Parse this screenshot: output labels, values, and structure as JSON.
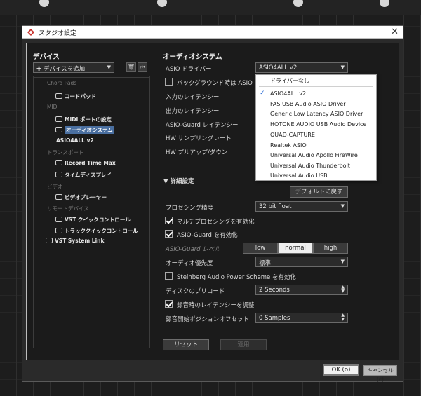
{
  "window": {
    "title": "スタジオ設定",
    "close": "✕"
  },
  "left": {
    "section_title": "デバイス",
    "add_device": "✚ デバイスを追加",
    "add_arrow": "▼",
    "tree": [
      {
        "type": "category",
        "label": "Chord Pads"
      },
      {
        "type": "item",
        "label": "コードパッド"
      },
      {
        "type": "category",
        "label": "MIDI"
      },
      {
        "type": "item",
        "label": "MIDI ポートの設定"
      },
      {
        "type": "item",
        "label": "オーディオシステム",
        "selected": true
      },
      {
        "type": "item",
        "label": "ASIO4ALL v2",
        "noicon": true
      },
      {
        "type": "category",
        "label": "トランスポート"
      },
      {
        "type": "item",
        "label": "Record Time Max"
      },
      {
        "type": "item",
        "label": "タイムディスプレイ"
      },
      {
        "type": "category",
        "label": "ビデオ"
      },
      {
        "type": "item",
        "label": "ビデオプレーヤー"
      },
      {
        "type": "category",
        "label": "リモートデバイス"
      },
      {
        "type": "item",
        "label": "VST クイックコントロール"
      },
      {
        "type": "item",
        "label": "トラッククイックコントロール"
      },
      {
        "type": "item",
        "label": "VST System Link",
        "root": true
      }
    ]
  },
  "right": {
    "section_title": "オーディオシステム",
    "asio_driver_label": "ASIO ドライバー",
    "asio_driver_value": "ASIO4ALL v2",
    "release_driver_label": "バックグラウンド時は ASIO ドライバー",
    "input_latency_label": "入力のレイテンシー",
    "output_latency_label": "出力のレイテンシー",
    "asio_guard_latency_label": "ASIO-Guard レイテンシー",
    "hw_sample_rate_label": "HW サンプリングレート",
    "hw_pullup_label": "HW プルアップ/ダウン",
    "advanced_label": "▼  詳細設定",
    "reset_default_button": "デフォルトに戻す",
    "processing_precision_label": "プロセシング精度",
    "processing_precision_value": "32 bit float",
    "multi_processing_label": "マルチプロセシングを有効化",
    "asio_guard_enable_label": "ASIO-Guard を有効化",
    "asio_guard_level_label": "ASIO-Guard レベル",
    "asio_guard_levels": [
      "low",
      "normal",
      "high"
    ],
    "audio_priority_label": "オーディオ優先度",
    "audio_priority_value": "標準",
    "steinberg_power_label": "Steinberg Audio Power Scheme を有効化",
    "disk_preload_label": "ディスクのプリロード",
    "disk_preload_value": "2 Seconds",
    "adjust_latency_label": "録音時のレイテンシーを調整",
    "record_shift_label": "録音開始ポジションオフセット",
    "record_shift_value": "0 Samples",
    "reset_button": "リセット",
    "apply_button": "適用"
  },
  "driver_menu": {
    "items": [
      "ドライバーなし",
      "ASIO4ALL v2",
      "FAS USB Audio ASIO Driver",
      "Generic Low Latency ASIO Driver",
      "HOTONE AUDIO USB Audio Device",
      "QUAD-CAPTURE",
      "Realtek ASIO",
      "Universal Audio Apollo FireWire",
      "Universal Audio Thunderbolt",
      "Universal Audio USB"
    ],
    "selected": "ASIO4ALL v2",
    "check": "✓"
  },
  "footer": {
    "ok": "OK (o)",
    "cancel": "キャンセル (c)"
  }
}
